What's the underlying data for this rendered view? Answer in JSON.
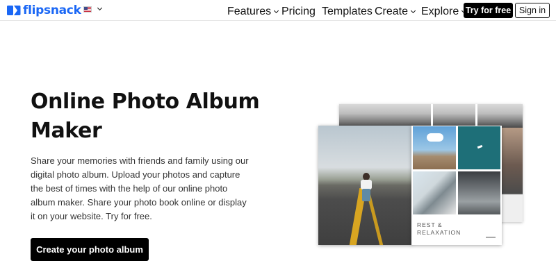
{
  "header": {
    "brand": "flipsnack",
    "language_flag": "us-flag-icon",
    "nav": [
      {
        "label": "Features",
        "has_dropdown": true
      },
      {
        "label": "Pricing",
        "has_dropdown": false
      },
      {
        "label": "Templates",
        "has_dropdown": false
      },
      {
        "label": "Create",
        "has_dropdown": true
      },
      {
        "label": "Explore",
        "has_dropdown": true
      }
    ],
    "try_label": "Try for free",
    "signin_label": "Sign in"
  },
  "hero": {
    "title": "Online Photo Album Maker",
    "description": "Share your memories with friends and family using our digital photo album. Upload your photos and capture the best of times with the help of our online photo album maker. Share your photo book online or display it on your website. Try for free.",
    "cta_label": "Create your photo album"
  },
  "album": {
    "caption": "REST &\nRELAXATION"
  },
  "colors": {
    "brand": "#1a67f5",
    "button_bg": "#000000",
    "button_text": "#ffffff"
  }
}
